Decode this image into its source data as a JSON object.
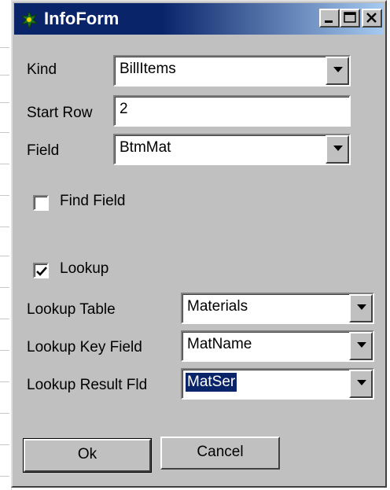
{
  "window": {
    "title": "InfoForm",
    "title_icon": "app-icon",
    "controls": [
      "minimize-icon",
      "maximize-icon",
      "close-icon"
    ]
  },
  "form": {
    "kind_label": "Kind",
    "kind_value": "BillItems",
    "start_row_label": "Start Row",
    "start_row_value": "2",
    "field_label": "Field",
    "field_value": "BtmMat",
    "find_field_label": "Find Field",
    "find_field_checked": false,
    "lookup_label": "Lookup",
    "lookup_checked": true,
    "lookup_table_label": "Lookup Table",
    "lookup_table_value": "Materials",
    "lookup_key_label": "Lookup Key Field",
    "lookup_key_value": "MatName",
    "lookup_result_label": "Lookup Result Fld",
    "lookup_result_value": "MatSer"
  },
  "buttons": {
    "ok_label": "Ok",
    "cancel_label": "Cancel"
  },
  "colors": {
    "titlebar": "#0a246a",
    "face": "#c0c0c0",
    "selection": "#0a246a"
  }
}
